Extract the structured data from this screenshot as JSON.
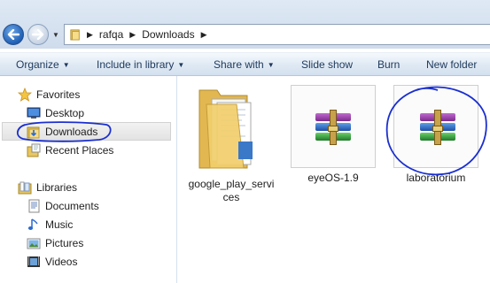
{
  "address_bar": {
    "breadcrumbs": [
      "rafqa",
      "Downloads"
    ]
  },
  "toolbar": {
    "items": [
      {
        "label": "Organize",
        "dropdown": true
      },
      {
        "label": "Include in library",
        "dropdown": true
      },
      {
        "label": "Share with",
        "dropdown": true
      },
      {
        "label": "Slide show",
        "dropdown": false
      },
      {
        "label": "Burn",
        "dropdown": false
      },
      {
        "label": "New folder",
        "dropdown": false
      }
    ]
  },
  "nav_pane": {
    "favorites": {
      "label": "Favorites",
      "items": [
        {
          "label": "Desktop",
          "icon": "desktop-icon"
        },
        {
          "label": "Downloads",
          "icon": "downloads-folder-icon",
          "selected": true
        },
        {
          "label": "Recent Places",
          "icon": "recent-places-icon"
        }
      ]
    },
    "libraries": {
      "label": "Libraries",
      "items": [
        {
          "label": "Documents",
          "icon": "documents-icon"
        },
        {
          "label": "Music",
          "icon": "music-icon"
        },
        {
          "label": "Pictures",
          "icon": "pictures-icon"
        },
        {
          "label": "Videos",
          "icon": "videos-icon"
        }
      ]
    }
  },
  "files": [
    {
      "name": "google_play_servi\nces",
      "line1": "google_play_servi",
      "line2": "ces",
      "type": "folder",
      "icon": "folder-icon"
    },
    {
      "name": "eyeOS-1.9",
      "type": "rar",
      "icon": "winrar-archive-icon"
    },
    {
      "name": "laboratorium",
      "type": "rar",
      "icon": "winrar-archive-icon",
      "hovered": true
    }
  ],
  "colors": {
    "annotation": "#1a2fd0",
    "toolbar_text": "#1e395b",
    "window_frame": "#cfdcec"
  }
}
